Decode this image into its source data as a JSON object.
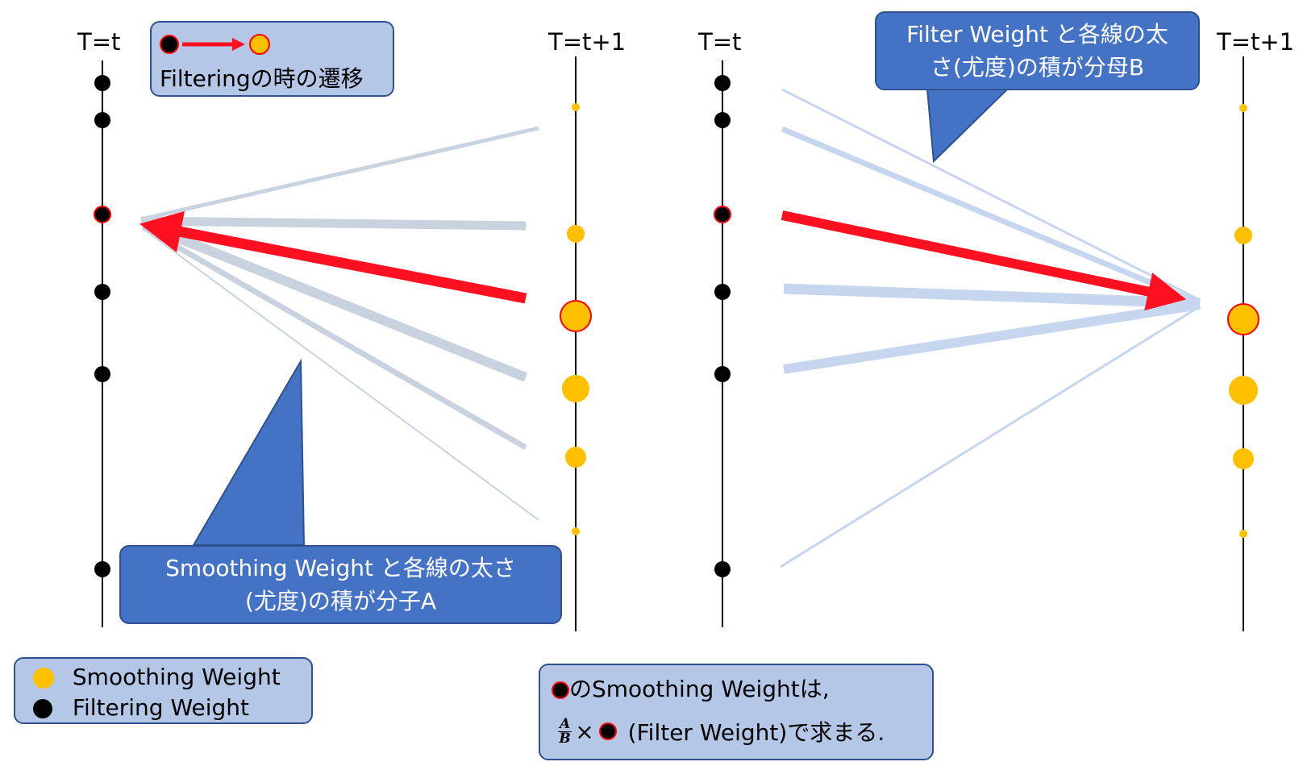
{
  "left_panel": {
    "time_label_left": "T=t",
    "time_label_right": "T=t+1",
    "legend_box": {
      "text": "Filteringの時の遷移"
    },
    "callout": {
      "line1": "Smoothing Weight と各線の太さ",
      "line2": "(尤度)の積が分子A"
    }
  },
  "right_panel": {
    "time_label_left": "T=t",
    "time_label_right": "T=t+1",
    "callout": {
      "line1": "Filter Weight と各線の太",
      "line2": "さ(尤度)の積が分母B"
    }
  },
  "legend": {
    "smoothing": "Smoothing Weight",
    "filtering": "Filtering Weight"
  },
  "formula": {
    "line1_suffix": "のSmoothing Weightは,",
    "frac_num": "A",
    "frac_den": "B",
    "times": "×",
    "line2_suffix": "(Filter Weight)で求まる."
  },
  "colors": {
    "filter_dot": "#000000",
    "smoothing_dot": "#ffc000",
    "highlight": "#ff0000",
    "highlight_arrow": "#ff1020",
    "left_lines": "#c9d3e0",
    "right_lines": "#c6d6ee",
    "box_fill": "#b4c7e7",
    "callout_fill": "#4472c4",
    "box_border": "#2f528f"
  }
}
